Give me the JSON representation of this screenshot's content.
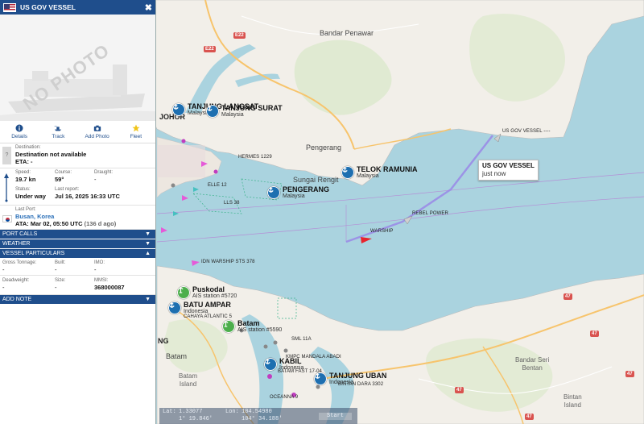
{
  "panel": {
    "title": "US GOV VESSEL",
    "close_label": "✖",
    "photo_placeholder": "NO PHOTO",
    "actions": [
      "Details",
      "Track",
      "Add Photo",
      "Fleet"
    ],
    "destination_label": "Destination:",
    "destination_value": "Destination not available",
    "eta_label": "ETA:",
    "eta_value": "-",
    "speed_label": "Speed:",
    "speed_value": "19.7 kn",
    "course_label": "Course:",
    "course_value": "59°",
    "draught_label": "Draught:",
    "draught_value": "-",
    "status_label": "Status:",
    "status_value": "Under way",
    "last_report_label": "Last report:",
    "last_report_value": "Jul 16, 2025 16:33 UTC",
    "last_port_label": "Last Port:",
    "last_port_value": "Busan, Korea",
    "ata_label": "ATA:",
    "ata_value": "Mar 02, 05:50 UTC",
    "ata_ago": "(136 d ago)",
    "sections": [
      {
        "label": "PORT CALLS",
        "chevron": "▼"
      },
      {
        "label": "WEATHER",
        "chevron": "▼"
      },
      {
        "label": "VESSEL PARTICULARS",
        "chevron": "▲"
      }
    ],
    "gross_tonnage_label": "Gross Tonnage:",
    "gross_tonnage_value": "-",
    "built_label": "Built:",
    "built_value": "-",
    "imo_label": "IMO:",
    "imo_value": "-",
    "deadweight_label": "Deadweight:",
    "deadweight_value": "-",
    "size_label": "Size:",
    "size_value": "-",
    "mmsi_label": "MMSI:",
    "mmsi_value": "368000087",
    "add_note": {
      "label": "ADD NOTE",
      "chevron": "▼"
    }
  },
  "map": {
    "ports": [
      {
        "name": "TANJUNG LANGSAT",
        "country": "Malaysia"
      },
      {
        "name": "TANJUNG SURAT",
        "country": "Malaysia"
      },
      {
        "name": "TELOK RAMUNIA",
        "country": "Malaysia"
      },
      {
        "name": "PENGERANG",
        "country": "Malaysia"
      },
      {
        "name": "Puskodal",
        "country": "AIS station #5720"
      },
      {
        "name": "BATU AMPAR",
        "country": "Indonesia"
      },
      {
        "name": "Batam",
        "country": "AIS station #5590"
      },
      {
        "name": "KABIL",
        "country": "Indonesia"
      },
      {
        "name": "TANJUNG UBAN",
        "country": "Indonesia"
      }
    ],
    "places": {
      "johor": "JOHOR",
      "bandar_penawar": "Bandar Penawar",
      "pengerang": "Pengerang",
      "sungai_rengit": "Sungai Rengit",
      "batam": "Batam",
      "batam_island": "Batam\nIsland",
      "bandar_seri_bentan": "Bandar Seri\nBentan",
      "bintan_island": "Bintan\nIsland",
      "ng": "NG"
    },
    "ship_labels": {
      "us_gov_vessel_track": "US GOV VESSEL ----",
      "rebel_power": "REBEL POWER",
      "warship": "WARSHIP",
      "idn_warship": "IDN WARSHIP STS 378",
      "hermes": "HERMES 1229",
      "oceanna": "OCEANNA 9",
      "cahaya": "CAHAYA ATLANTIC 5",
      "sml": "SML 11A",
      "mandala": "KMPC MANDALA ABADI",
      "ferry": "BATAM FAST 17-04",
      "dara": "BINTAN DARA 3302",
      "lls": "LLS 38",
      "elle": "ELLE 12"
    },
    "road_shields": [
      "E22",
      "E22",
      "47",
      "47",
      "47",
      "47",
      "47"
    ],
    "selected_vessel": {
      "name": "US GOV VESSEL",
      "time": "just now"
    }
  },
  "coords": {
    "lat_label": "Lat:",
    "lat_dec": "1.33077",
    "lat_dms": "1° 19.846'",
    "lon_label": "Lon:",
    "lon_dec": "104.54980",
    "lon_dms": "104° 34.188'",
    "button": "Start"
  },
  "colors": {
    "panel_header": "#1f4e8c",
    "sea": "#aad3df",
    "land": "#f2efe9",
    "track": "#9a87e8",
    "port_marker": "#1e6fb0",
    "ais_station": "#4cae4c"
  }
}
